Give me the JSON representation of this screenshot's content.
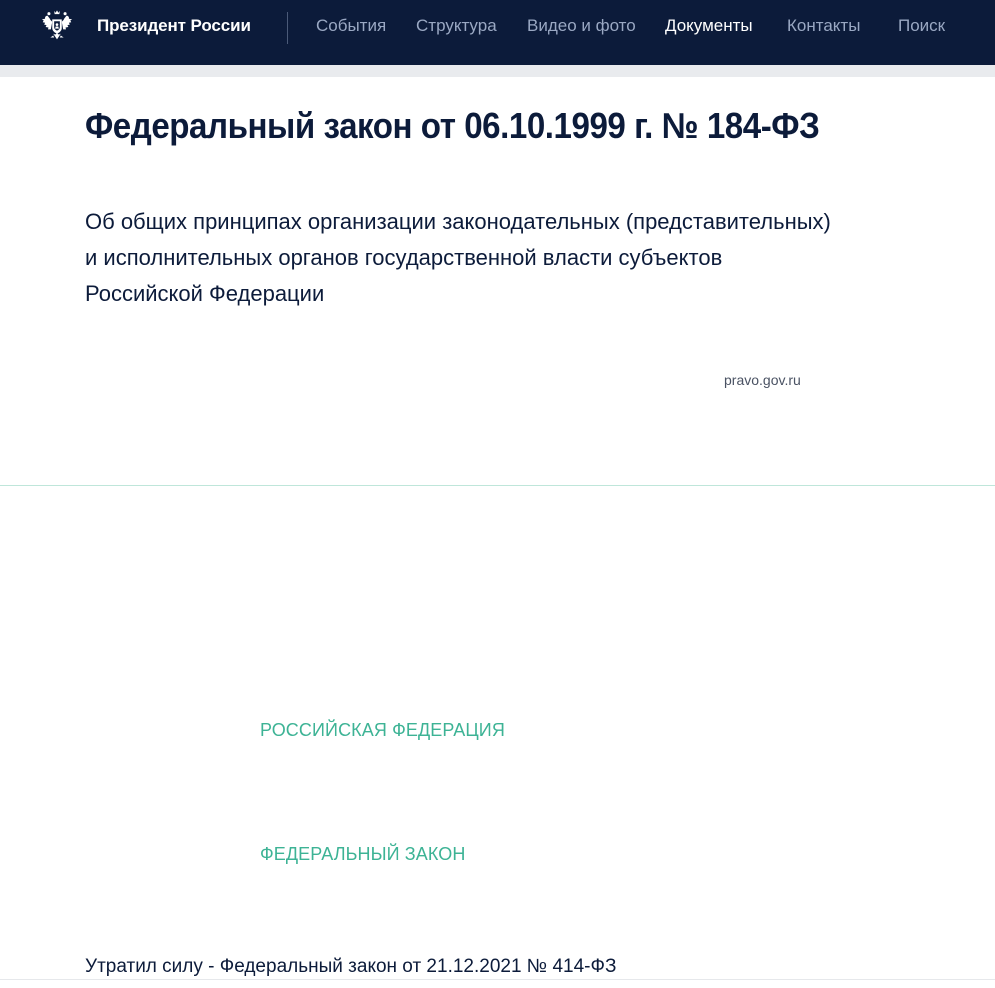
{
  "header": {
    "brand": "Президент России",
    "emblem_icon": "double-headed-eagle-icon",
    "nav": [
      {
        "label": "События",
        "active": false
      },
      {
        "label": "Структура",
        "active": false
      },
      {
        "label": "Видео и фото",
        "active": false
      },
      {
        "label": "Документы",
        "active": true
      },
      {
        "label": "Контакты",
        "active": false
      },
      {
        "label": "Поиск",
        "active": false
      }
    ]
  },
  "document": {
    "title": "Федеральный закон от 06.10.1999 г. № 184-ФЗ",
    "summary": "Об общих принципах организации законодательных (представительных) и исполнительных органов государственной власти субъектов Российской Федерации",
    "source": "pravo.gov.ru",
    "country_heading": "РОССИЙСКАЯ ФЕДЕРАЦИЯ",
    "type_heading": "ФЕДЕРАЛЬНЫЙ ЗАКОН",
    "repeal_note": "Утратил силу - Федеральный закон от 21.12.2021 № 414-ФЗ"
  },
  "colors": {
    "header_bg": "#0c1b3a",
    "accent_green": "#3db395",
    "nav_inactive": "#9aa8c3"
  }
}
